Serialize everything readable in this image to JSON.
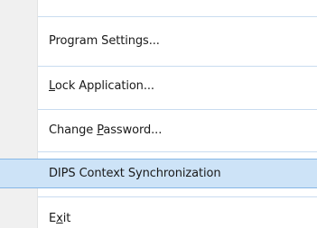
{
  "menu": {
    "items": [
      {
        "before": "Program Settings...",
        "mnemonic": "",
        "after": ""
      },
      {
        "before": "",
        "mnemonic": "L",
        "after": "ock Application..."
      },
      {
        "before": "Change ",
        "mnemonic": "P",
        "after": "assword..."
      },
      {
        "before": "DIPS Context Synchronization",
        "mnemonic": "",
        "after": "",
        "highlighted": true
      },
      {
        "before": "E",
        "mnemonic": "x",
        "after": "it"
      }
    ]
  },
  "colors": {
    "gutter": "#f0f0f0",
    "separator": "#c9dcf0",
    "highlight_fill": "#cde3f7",
    "highlight_border": "#86b7e6"
  }
}
